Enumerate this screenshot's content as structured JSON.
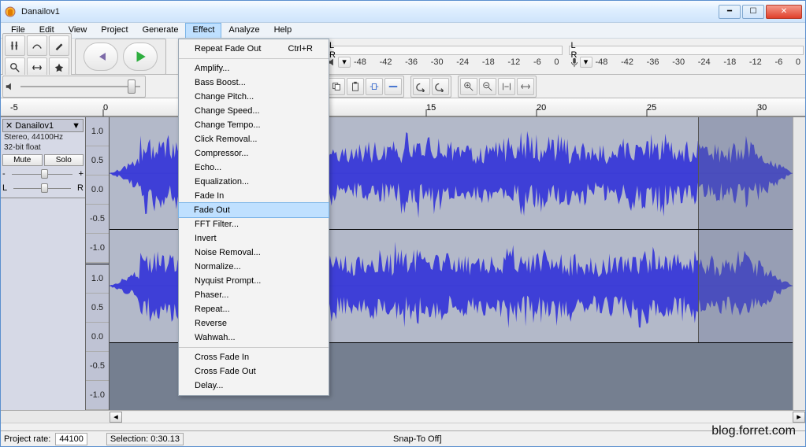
{
  "title": "Danailov1",
  "menus": [
    "File",
    "Edit",
    "View",
    "Project",
    "Generate",
    "Effect",
    "Analyze",
    "Help"
  ],
  "effect_menu": {
    "repeat": {
      "label": "Repeat Fade Out",
      "shortcut": "Ctrl+R"
    },
    "items": [
      "Amplify...",
      "Bass Boost...",
      "Change Pitch...",
      "Change Speed...",
      "Change Tempo...",
      "Click Removal...",
      "Compressor...",
      "Echo...",
      "Equalization...",
      "Fade In",
      "Fade Out",
      "FFT Filter...",
      "Invert",
      "Noise Removal...",
      "Normalize...",
      "Nyquist Prompt...",
      "Phaser...",
      "Repeat...",
      "Reverse",
      "Wahwah..."
    ],
    "highlighted": "Fade Out",
    "extra": [
      "Cross Fade In",
      "Cross Fade Out",
      "Delay..."
    ]
  },
  "db_ticks": [
    "-48",
    "-42",
    "-36",
    "-30",
    "-24",
    "-18",
    "-12",
    "-6",
    "0"
  ],
  "ruler_ticks": [
    "-5",
    "0",
    "15",
    "20",
    "25",
    "30"
  ],
  "track": {
    "name": "Danailov1",
    "format": "Stereo, 44100Hz",
    "bits": "32-bit float",
    "mute": "Mute",
    "solo": "Solo",
    "pan_l": "L",
    "pan_r": "R"
  },
  "vscale": [
    "1.0",
    "0.5",
    "0.0",
    "-0.5",
    "-1.0"
  ],
  "status": {
    "rate_label": "Project rate:",
    "rate_value": "44100",
    "selection": "Selection: 0:30.13",
    "snap": "Snap-To Off]"
  },
  "meter_labels": {
    "l": "L",
    "r": "R"
  },
  "watermark": "blog.forret.com"
}
